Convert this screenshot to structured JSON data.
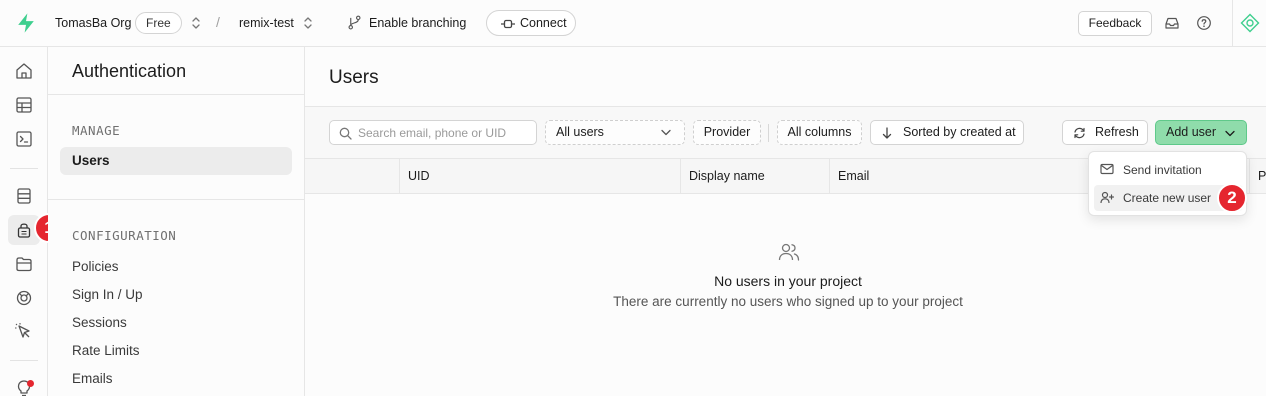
{
  "topbar": {
    "org_name": "TomasBa Org",
    "plan_badge": "Free",
    "separator": "/",
    "project_name": "remix-test",
    "branching_label": "Enable branching",
    "connect_label": "Connect",
    "feedback_label": "Feedback",
    "brand_color": "#3ecf8e"
  },
  "rail": {
    "icons": [
      "home-icon",
      "table-editor-icon",
      "sql-editor-icon",
      "database-icon",
      "auth-icon",
      "storage-icon",
      "realtime-icon",
      "edge-functions-icon",
      "advisor-icon"
    ],
    "active": "auth-icon"
  },
  "annotations": {
    "step1": "1",
    "step2": "2",
    "color": "#e5262f"
  },
  "sidebar": {
    "title": "Authentication",
    "manage_heading": "MANAGE",
    "manage_items": [
      {
        "label": "Users",
        "active": true
      }
    ],
    "config_heading": "CONFIGURATION",
    "config_items": [
      {
        "label": "Policies"
      },
      {
        "label": "Sign In / Up"
      },
      {
        "label": "Sessions"
      },
      {
        "label": "Rate Limits"
      },
      {
        "label": "Emails"
      }
    ]
  },
  "main": {
    "title": "Users",
    "search_placeholder": "Search email, phone or UID",
    "filter_users": "All users",
    "provider_label": "Provider",
    "columns_label": "All columns",
    "sort_label": "Sorted by created at",
    "refresh_label": "Refresh",
    "add_user_label": "Add user",
    "add_user_color": "#8fdcab",
    "columns": [
      "UID",
      "Display name",
      "Email",
      "P"
    ],
    "empty_title": "No users in your project",
    "empty_subtitle": "There are currently no users who signed up to your project"
  },
  "add_user_menu": {
    "items": [
      {
        "label": "Send invitation",
        "icon": "mail-icon"
      },
      {
        "label": "Create new user",
        "icon": "user-plus-icon",
        "highlighted": true
      }
    ]
  }
}
